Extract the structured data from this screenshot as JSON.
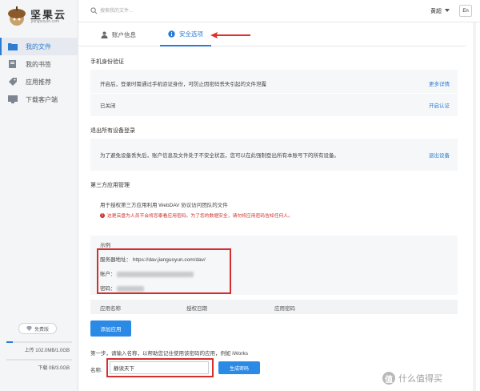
{
  "app": {
    "name": "坚果云",
    "domain": "jianguoyun.com"
  },
  "sidebar": {
    "items": [
      {
        "label": "我的文件",
        "icon": "folder-icon",
        "active": true
      },
      {
        "label": "我的书签",
        "icon": "bookmark-icon",
        "active": false
      },
      {
        "label": "应用推荐",
        "icon": "tag-icon",
        "active": false
      },
      {
        "label": "下载客户端",
        "icon": "monitor-icon",
        "active": false
      }
    ],
    "plan_badge": "免费版",
    "upload": {
      "label": "上传 102.0MB/1.0GB",
      "fraction": 0.1
    },
    "download": {
      "label": "下载 0B/3.0GB",
      "fraction": 0.0
    }
  },
  "topbar": {
    "search_placeholder": "搜索我的文件...",
    "user_name": "黄超",
    "lang_button": "En"
  },
  "tabs": [
    {
      "label": "账户信息",
      "icon": "user-icon",
      "active": false
    },
    {
      "label": "安全选项",
      "icon": "info-icon",
      "active": true
    }
  ],
  "security": {
    "phone_verify": {
      "title": "手机身份验证",
      "description": "开启后，登录时需通过手机验证身份，可防止因密码丢失引起的文件泄露",
      "more_link": "更多详情",
      "status": "已关闭",
      "enable_link": "开启认证"
    },
    "logout_all": {
      "title": "退出所有设备登录",
      "description": "为了避免设备丢失后，账户信息及文件处于不安全状态，您可以在此强制登出所有本账号下的所有设备。",
      "action_link": "退出设备"
    },
    "third_party": {
      "title": "第三方应用管理",
      "description": "用于授权第三方应用利用 WebDAV 协议访问团队的文件",
      "warning": "这是云盘为人员不会将您泰看应用密码。为了您的数据安全，请勿将应用密码告知任何人。",
      "example_label": "示例",
      "server_label": "服务器地址：",
      "server_value": "https://dav.jianguoyun.com/dav/",
      "account_label": "账户：",
      "password_label": "密码：",
      "table_headers": [
        "应用名称",
        "授权日期",
        "应用密码"
      ],
      "add_button": "添加应用",
      "step_text": "第一步，请输入名称，以帮助您记住使用该密码的应用，例如 iWorks",
      "name_label": "名称:",
      "name_value": "静读天下",
      "generate_button": "生成密码"
    }
  },
  "watermark": {
    "badge": "值",
    "text": "什么值得买"
  },
  "colors": {
    "accent": "#2b7cd3",
    "button": "#2b8ae6",
    "highlight_red": "#d32f2f",
    "warning_red": "#d0312d"
  }
}
